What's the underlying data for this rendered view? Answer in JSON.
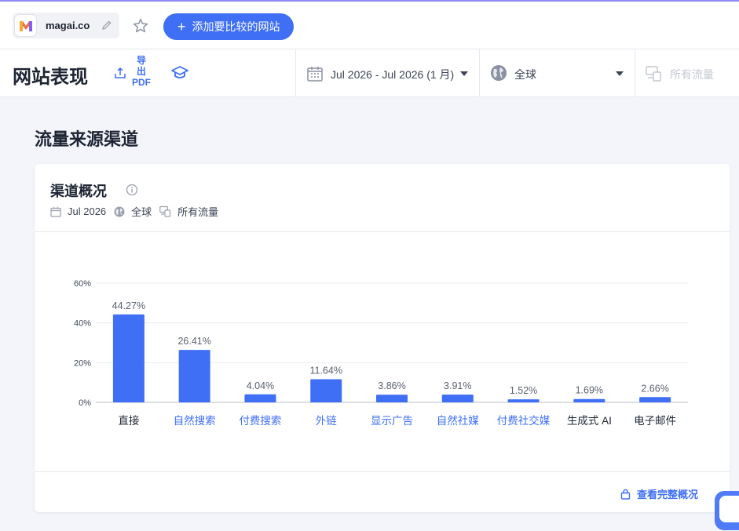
{
  "topbar": {
    "site_name": "magai.co",
    "add_compare_label": "添加要比较的网站",
    "add_compare_plus": "+"
  },
  "subbar": {
    "page_title": "网站表现",
    "export_label_1": "导",
    "export_label_2": "出",
    "export_label_3": "PDF",
    "date_range": "Jul 2026 - Jul 2026 (1 月)",
    "region": "全球",
    "traffic_type": "所有流量"
  },
  "section": {
    "title": "流量来源渠道"
  },
  "card": {
    "title": "渠道概况",
    "meta_date": "Jul 2026",
    "meta_region": "全球",
    "meta_traffic": "所有流量",
    "full_link": "查看完整概况"
  },
  "colors": {
    "accent": "#3e6ff4",
    "bar": "#3e6ff4",
    "link_category": "#3e6ff4",
    "plain_category": "#1d2433"
  },
  "icons": {
    "logo": "magai-logo",
    "edit": "pencil-icon",
    "favorite": "star-icon",
    "export": "export-icon",
    "learn": "graduation-cap-icon",
    "calendar": "calendar-icon",
    "globe": "globe-icon",
    "devices": "devices-icon",
    "info": "info-icon",
    "lock": "lock-icon",
    "chat": "chat-icon"
  },
  "chart_data": {
    "type": "bar",
    "categories": [
      "直接",
      "自然搜索",
      "付费搜索",
      "外链",
      "显示广告",
      "自然社媒",
      "付费社交媒",
      "生成式 AI",
      "电子邮件"
    ],
    "category_is_link": [
      false,
      true,
      true,
      true,
      true,
      true,
      true,
      false,
      false
    ],
    "values": [
      44.27,
      26.41,
      4.04,
      11.64,
      3.86,
      3.91,
      1.52,
      1.69,
      2.66
    ],
    "value_labels": [
      "44.27%",
      "26.41%",
      "4.04%",
      "11.64%",
      "3.86%",
      "3.91%",
      "1.52%",
      "1.69%",
      "2.66%"
    ],
    "yticks": [
      0,
      20,
      40,
      60
    ],
    "ytick_labels": [
      "0%",
      "20%",
      "40%",
      "60%"
    ],
    "ylim": [
      0,
      60
    ],
    "title": "",
    "xlabel": "",
    "ylabel": "",
    "grid": true
  }
}
